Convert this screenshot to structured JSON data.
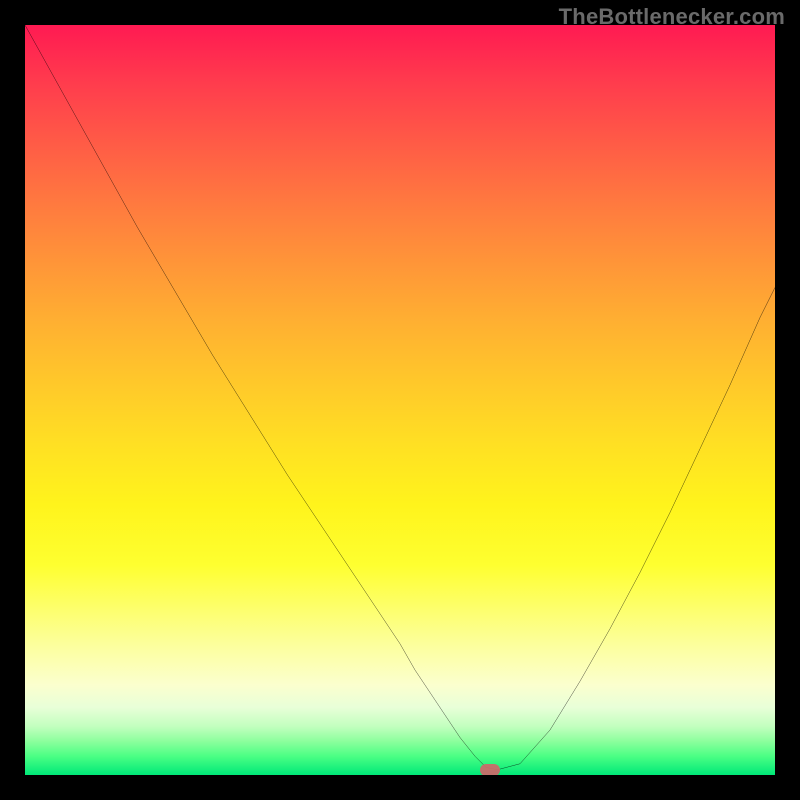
{
  "attribution": "TheBottlenecker.com",
  "chart_data": {
    "type": "line",
    "title": "",
    "xlabel": "",
    "ylabel": "",
    "xlim": [
      0,
      100
    ],
    "ylim": [
      0,
      100
    ],
    "x": [
      0,
      5,
      10,
      15,
      20,
      25,
      30,
      35,
      40,
      45,
      50,
      52,
      55,
      58,
      60,
      61.5,
      63,
      66,
      70,
      74,
      78,
      82,
      86,
      90,
      94,
      98,
      100
    ],
    "values": [
      100,
      91,
      82,
      73,
      64.5,
      56,
      48,
      40,
      32.5,
      25,
      17.5,
      14,
      9.5,
      5,
      2.5,
      1,
      0.7,
      1.5,
      6,
      12.5,
      19.5,
      27,
      35,
      43.5,
      52,
      61,
      65
    ],
    "marker": {
      "x": 62,
      "y": 0.7
    },
    "background_gradient": {
      "top": "#ff1a52",
      "mid": "#ffe023",
      "bottom": "#00e878"
    },
    "curve_color": "#000000",
    "frame_color": "#000000"
  }
}
